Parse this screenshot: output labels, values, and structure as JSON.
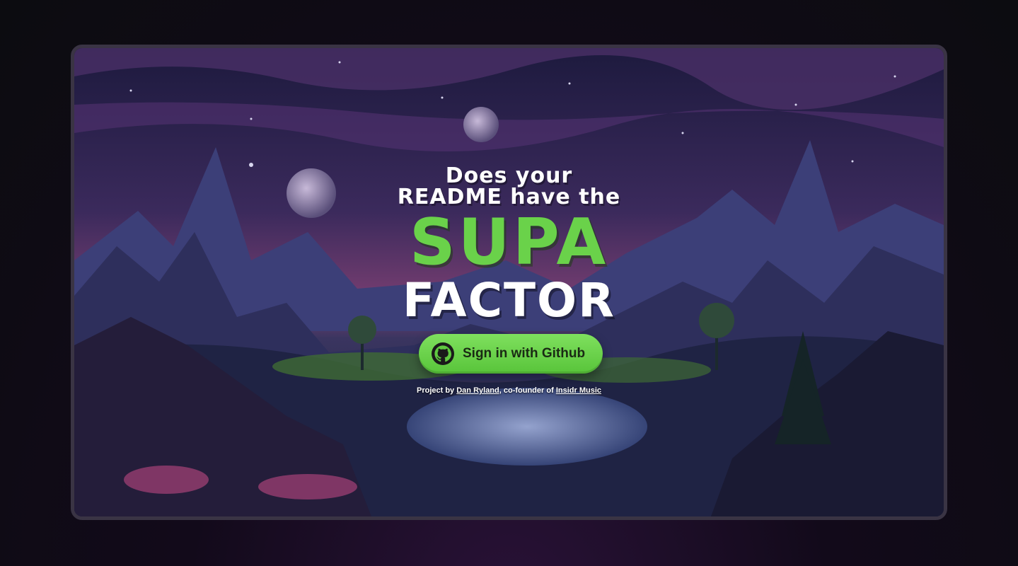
{
  "hero": {
    "line1": "Does your",
    "line2": "README have the",
    "highlight": "SUPA",
    "headline_end": "FACTOR"
  },
  "signin_button": {
    "label": "Sign in with Github",
    "icon": "github-icon"
  },
  "credit": {
    "prefix": "Project by",
    "author": "Dan Ryland",
    "middle": ", co-founder of",
    "company": "Insidr Music"
  },
  "colors": {
    "accent_green": "#6ad24a",
    "button_green": "#5fc940",
    "frame_border": "#3a3444"
  }
}
